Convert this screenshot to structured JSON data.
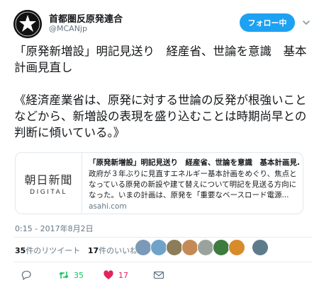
{
  "user": {
    "display_name": "首都圏反原発連合",
    "handle": "@MCANjp",
    "follow_label": "フォロー中"
  },
  "tweet": {
    "paragraph1": "「原発新増設」明記見送り　経産省、世論を意識　基本計画見直し",
    "paragraph2": "《経済産業省は、原発に対する世論の反発が根強いことなどから、新増設の表現を盛り込むことは時期尚早との判断に傾いている。》"
  },
  "card": {
    "logo_jp": "朝日新聞",
    "logo_en": "DIGITAL",
    "title": "「原発新増設」明記見送り　経産省、世論を意識　基本計画見...",
    "description": "政府が３年ぶりに見直すエネルギー基本計画をめぐり、焦点となっている原発の新設や建て替えについて明記を見送る方向になった。いまの計画は、原発を「重要なベースロード電源...",
    "domain": "asahi.com"
  },
  "timestamp": "0:15 - 2017年8月2日",
  "stats": {
    "retweets_num": "35",
    "retweets_label": "件のリツイート",
    "likes_num": "17",
    "likes_label": "件のいいね"
  },
  "actions": {
    "retweet_count": "35",
    "like_count": "17"
  },
  "colors": {
    "accent": "#1da1f2",
    "retweet": "#17bf63",
    "like": "#e0245e",
    "muted": "#657786"
  }
}
